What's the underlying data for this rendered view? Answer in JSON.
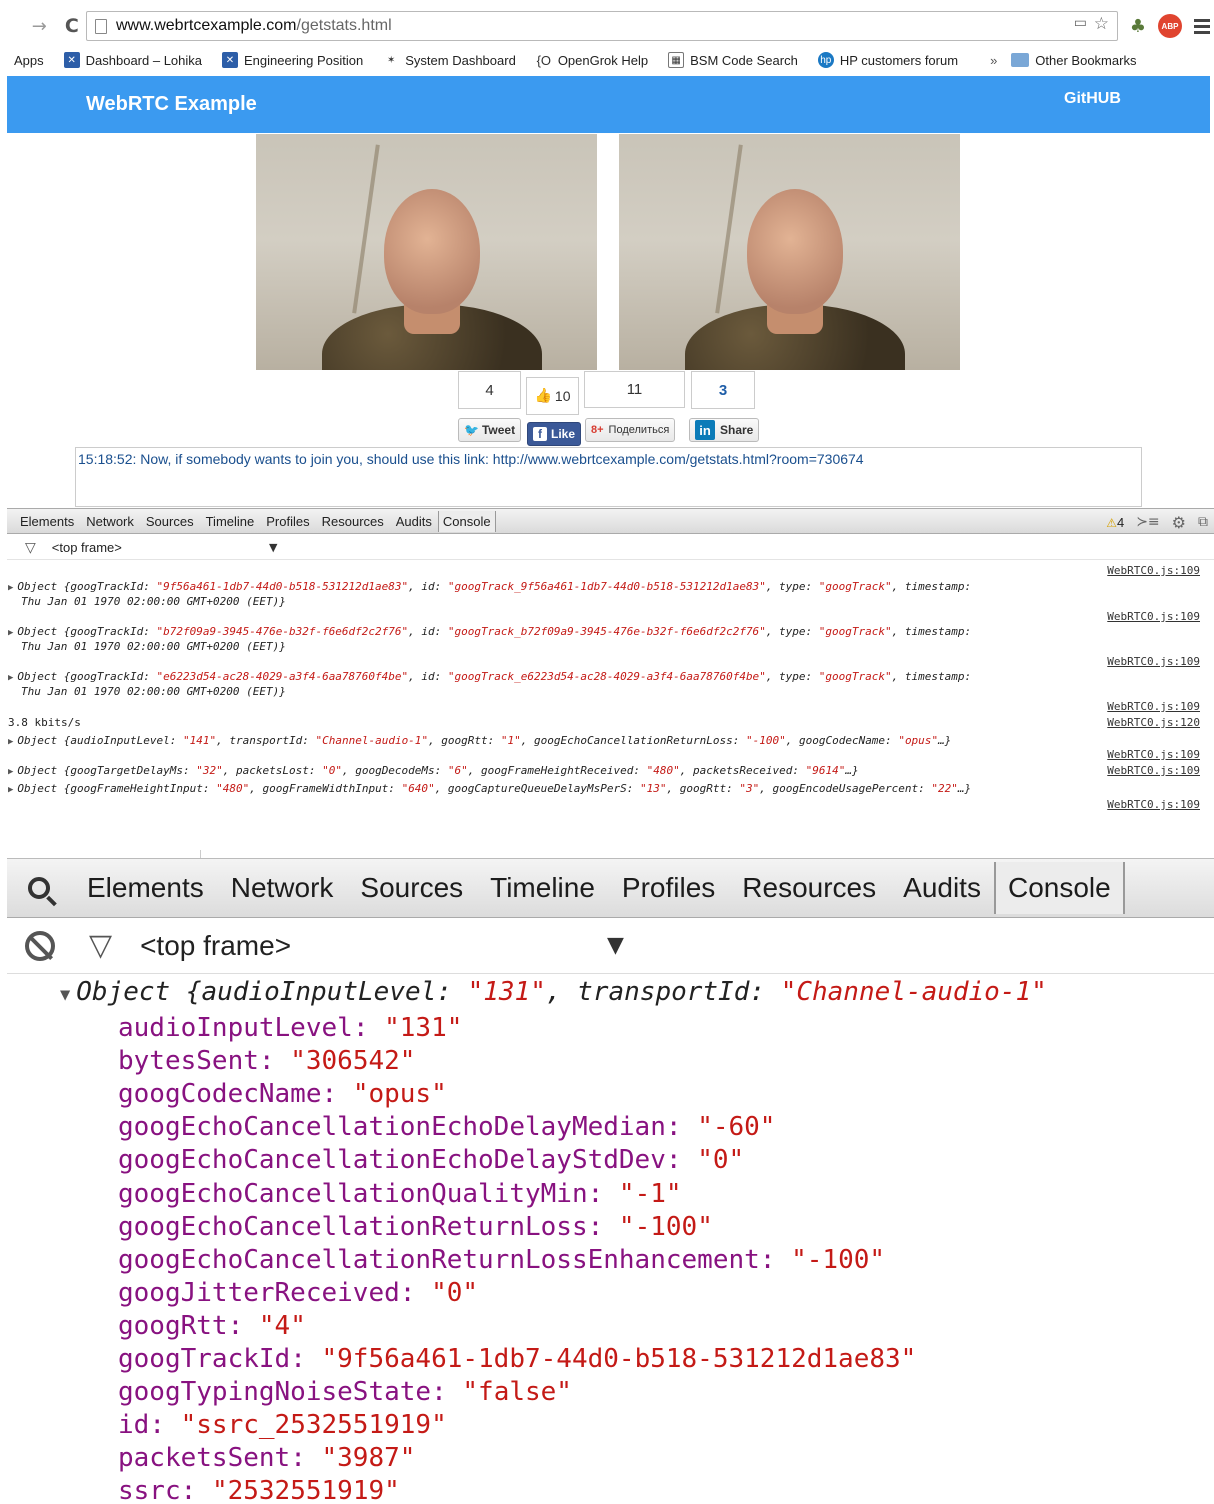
{
  "browser": {
    "url_host": "www.webrtcexample.com",
    "url_path": "/getstats.html",
    "bookmarks": [
      {
        "label": "Apps",
        "icon": "apps-icon",
        "color": ""
      },
      {
        "label": "Dashboard – Lohika",
        "icon": "jira-icon",
        "color": "#2d5ea8"
      },
      {
        "label": "Engineering Position",
        "icon": "jira-icon",
        "color": "#2d5ea8"
      },
      {
        "label": "System Dashboard",
        "icon": "jira-star-icon",
        "color": "#555555"
      },
      {
        "label": "OpenGrok Help",
        "icon": "opengrok-icon",
        "color": "#555555"
      },
      {
        "label": "BSM Code Search",
        "icon": "bsm-icon",
        "color": "#555555"
      },
      {
        "label": "HP customers forum",
        "icon": "hp-icon",
        "color": "#1b79c4"
      }
    ],
    "more_label": "»",
    "other_bookmarks": "Other Bookmarks",
    "abp_label": "ABP"
  },
  "page": {
    "brand": "WebRTC Example",
    "github": "GitHUB",
    "social": {
      "tweet_count": "4",
      "like_count": "10",
      "gplus_count": "11",
      "linkedin_count": "3",
      "tweet_label": "Tweet",
      "like_label": "Like",
      "gplus_label": "Поделиться",
      "share_label": "Share"
    },
    "chat_prefix": "15:18:52: Now, if somebody wants to join you, should use this link: ",
    "chat_link": "http://www.webrtcexample.com/getstats.html?room=730674"
  },
  "devtools": {
    "tabs": [
      "Elements",
      "Network",
      "Sources",
      "Timeline",
      "Profiles",
      "Resources",
      "Audits",
      "Console"
    ],
    "active_tab": "Console",
    "warning_count": "4",
    "frame": "<top frame>",
    "source_label": "WebRTC0.js:109",
    "source_label_120": "WebRTC0.js:120",
    "track_logs": [
      {
        "track_id": "9f56a461-1db7-44d0-b518-531212d1ae83",
        "id": "googTrack_9f56a461-1db7-44d0-b518-531212d1ae83"
      },
      {
        "track_id": "b72f09a9-3945-476e-b32f-f6e6df2c2f76",
        "id": "googTrack_b72f09a9-3945-476e-b32f-f6e6df2c2f76"
      },
      {
        "track_id": "e6223d54-ac28-4029-a3f4-6aa78760f4be",
        "id": "googTrack_e6223d54-ac28-4029-a3f4-6aa78760f4be"
      }
    ],
    "track_type": "googTrack",
    "timestamp_text": "Thu Jan 01 1970 02:00:00 GMT+0200 (EET)}",
    "bitrate": "3.8 kbits/s",
    "audio_line": {
      "audioInputLevel": "141",
      "transportId": "Channel-audio-1",
      "googRtt": "1",
      "googEchoCancellationReturnLoss": "-100",
      "googCodecName": "opus"
    },
    "recv_line": {
      "googTargetDelayMs": "32",
      "packetsLost": "0",
      "googDecodeMs": "6",
      "googFrameHeightReceived": "480",
      "packetsReceived": "9614"
    },
    "send_line": {
      "googFrameHeightInput": "480",
      "googFrameWidthInput": "640",
      "googCaptureQueueDelayMsPerS": "13",
      "googRtt": "3",
      "googEncodeUsagePercent": "22"
    }
  },
  "zoomed": {
    "header": {
      "audioInputLevel": "131",
      "transportId": "Channel-audio-1"
    },
    "props": [
      {
        "key": "audioInputLevel",
        "value": "\"131\""
      },
      {
        "key": "bytesSent",
        "value": "\"306542\""
      },
      {
        "key": "googCodecName",
        "value": "\"opus\""
      },
      {
        "key": "googEchoCancellationEchoDelayMedian",
        "value": "\"-60\""
      },
      {
        "key": "googEchoCancellationEchoDelayStdDev",
        "value": "\"0\""
      },
      {
        "key": "googEchoCancellationQualityMin",
        "value": "\"-1\""
      },
      {
        "key": "googEchoCancellationReturnLoss",
        "value": "\"-100\""
      },
      {
        "key": "googEchoCancellationReturnLossEnhancement",
        "value": "\"-100\""
      },
      {
        "key": "googJitterReceived",
        "value": "\"0\""
      },
      {
        "key": "googRtt",
        "value": "\"4\""
      },
      {
        "key": "googTrackId",
        "value": "\"9f56a461-1db7-44d0-b518-531212d1ae83\""
      },
      {
        "key": "googTypingNoiseState",
        "value": "\"false\""
      },
      {
        "key": "id",
        "value": "\"ssrc_2532551919\""
      },
      {
        "key": "packetsSent",
        "value": "\"3987\""
      },
      {
        "key": "ssrc",
        "value": "\"2532551919\""
      }
    ]
  }
}
